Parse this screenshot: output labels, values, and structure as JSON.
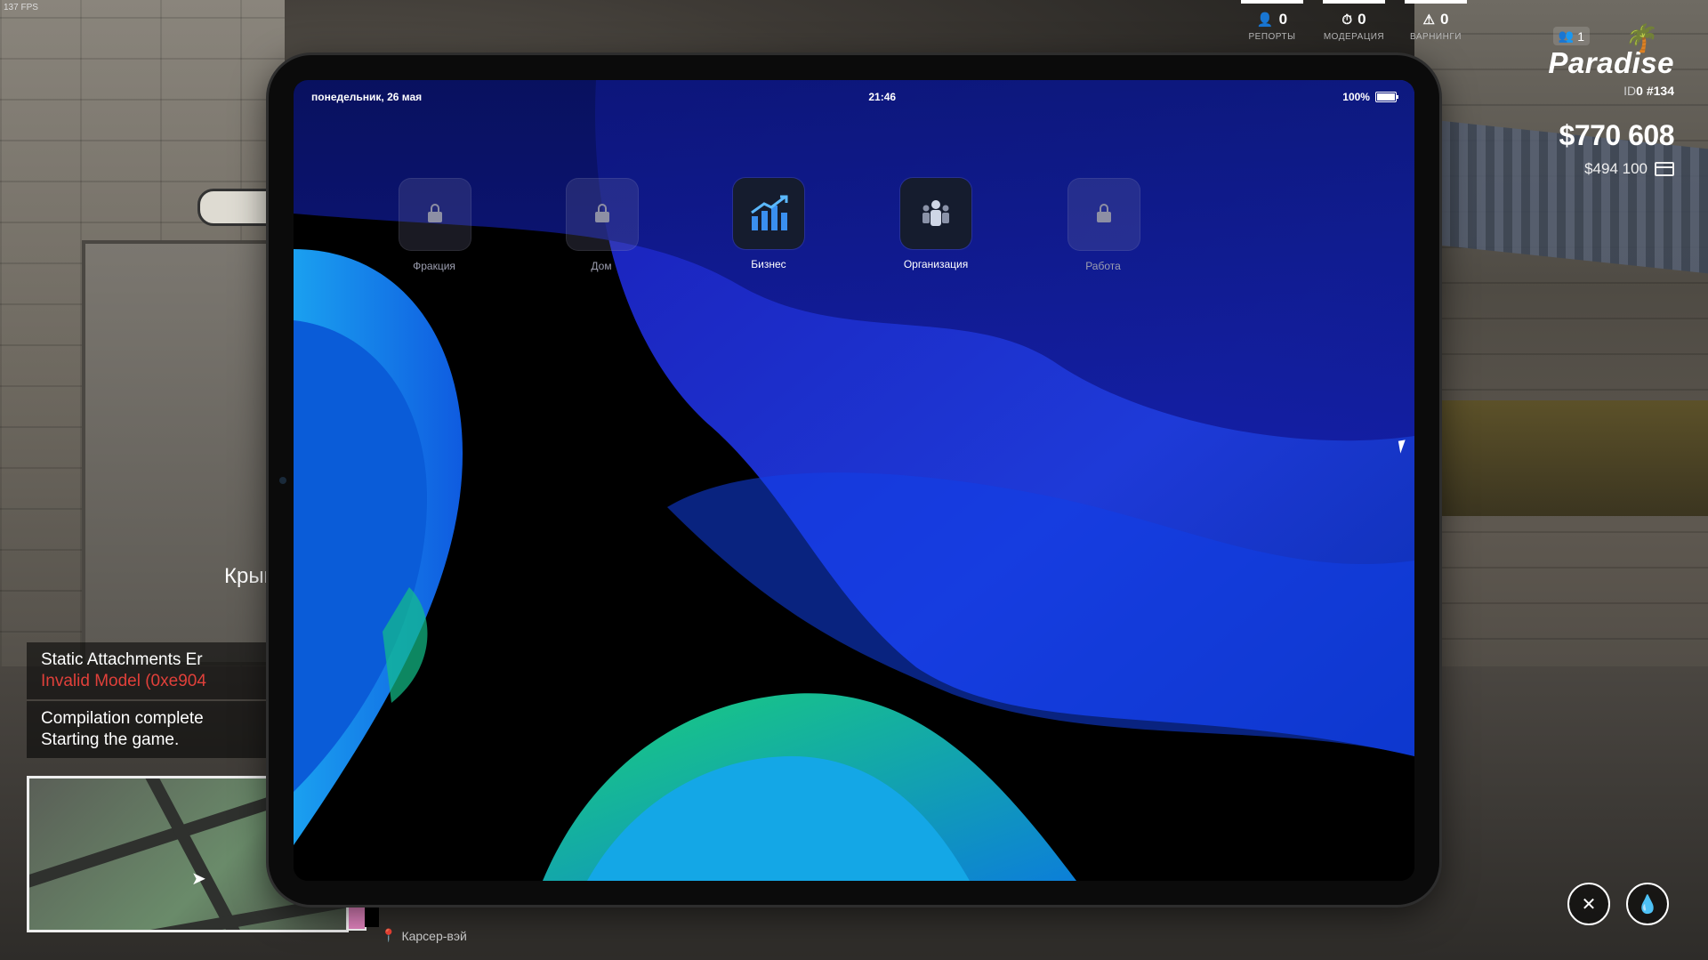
{
  "fps": "137 FPS",
  "hud": {
    "stats": [
      {
        "value": "0",
        "label": "РЕПОРТЫ",
        "icon": "report-icon"
      },
      {
        "value": "0",
        "label": "МОДЕРАЦИЯ",
        "icon": "moderation-icon"
      },
      {
        "value": "0",
        "label": "ВАРНИНГИ",
        "icon": "warning-icon"
      }
    ],
    "online": "1",
    "logo": "Paradise",
    "id_label": "ID",
    "id_value": "0",
    "id_number": "#134",
    "money": "$770 608",
    "bank": "$494 100"
  },
  "tablet": {
    "date": "понедельник, 26 мая",
    "time": "21:46",
    "battery": "100%",
    "apps": [
      {
        "label": "Фракция",
        "locked": true,
        "icon": "lock-icon"
      },
      {
        "label": "Дом",
        "locked": true,
        "icon": "lock-icon"
      },
      {
        "label": "Бизнес",
        "locked": false,
        "icon": "chart-icon"
      },
      {
        "label": "Организация",
        "locked": false,
        "icon": "people-icon"
      },
      {
        "label": "Работа",
        "locked": true,
        "icon": "lock-icon"
      }
    ]
  },
  "notifications": {
    "location": "Крыш",
    "n1_line1": "Static Attachments Er",
    "n1_line2": "Invalid Model (0xe904",
    "n2_line1": "Compilation complete",
    "n2_line2": "Starting the game."
  },
  "street": "Карсер-вэй",
  "colors": {
    "accent_green": "#5bd55e",
    "error_red": "#e0403a"
  }
}
